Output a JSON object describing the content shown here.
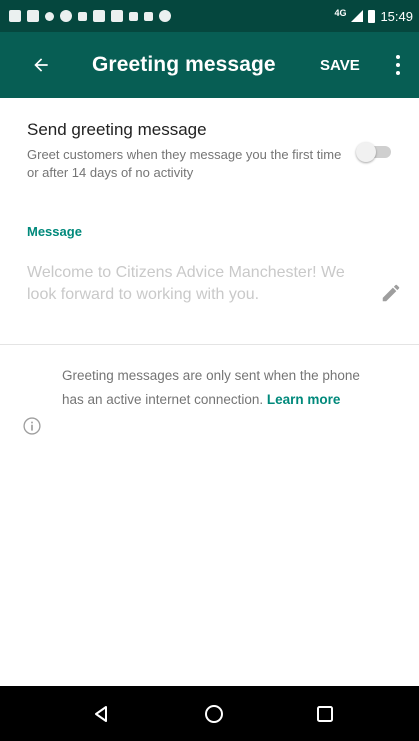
{
  "status_bar": {
    "network": "4G",
    "time": "15:49"
  },
  "app_bar": {
    "title": "Greeting message",
    "save_label": "SAVE",
    "back_icon": "arrow-back-icon",
    "more_icon": "more-vertical-icon"
  },
  "greeting": {
    "title": "Send greeting message",
    "description": "Greet customers when they message you the first time or after 14 days of no activity",
    "enabled": false
  },
  "message": {
    "section_label": "Message",
    "text": "Welcome to Citizens Advice Manchester! We look forward to working with you.",
    "edit_icon": "pencil-icon"
  },
  "info": {
    "icon": "info-icon",
    "text": "Greeting messages are only sent when the phone has an active internet connection. ",
    "link": "Learn more"
  },
  "nav": {
    "back_icon": "triangle-back-icon",
    "home_icon": "circle-home-icon",
    "recents_icon": "square-recents-icon"
  },
  "colors": {
    "app_bar": "#075e54",
    "status_bar": "#05473e",
    "accent": "#00897b"
  }
}
